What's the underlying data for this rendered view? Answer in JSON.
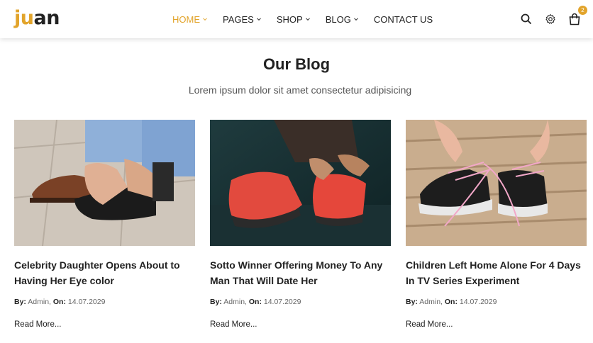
{
  "logo": {
    "part1": "ju",
    "part2": "an"
  },
  "nav": [
    {
      "label": "HOME"
    },
    {
      "label": "PAGES"
    },
    {
      "label": "SHOP"
    },
    {
      "label": "BLOG"
    },
    {
      "label": "CONTACT US"
    }
  ],
  "cart": {
    "count": "2"
  },
  "section": {
    "title": "Our Blog",
    "subtitle": "Lorem ipsum dolor sit amet consectetur adipisicing"
  },
  "posts": [
    {
      "title": "Celebrity Daughter Opens About to Having Her Eye color",
      "by_label": "By:",
      "author": "Admin,",
      "on_label": "On:",
      "date": "14.07.2029",
      "read_more": "Read More..."
    },
    {
      "title": "Sotto Winner Offering Money To Any Man That Will Date Her",
      "by_label": "By:",
      "author": "Admin,",
      "on_label": "On:",
      "date": "14.07.2029",
      "read_more": "Read More..."
    },
    {
      "title": "Children Left Home Alone For 4 Days In TV Series Experiment",
      "by_label": "By:",
      "author": "Admin,",
      "on_label": "On:",
      "date": "14.07.2029",
      "read_more": "Read More..."
    }
  ],
  "colors": {
    "accent": "#e2a42b",
    "text": "#222222"
  }
}
